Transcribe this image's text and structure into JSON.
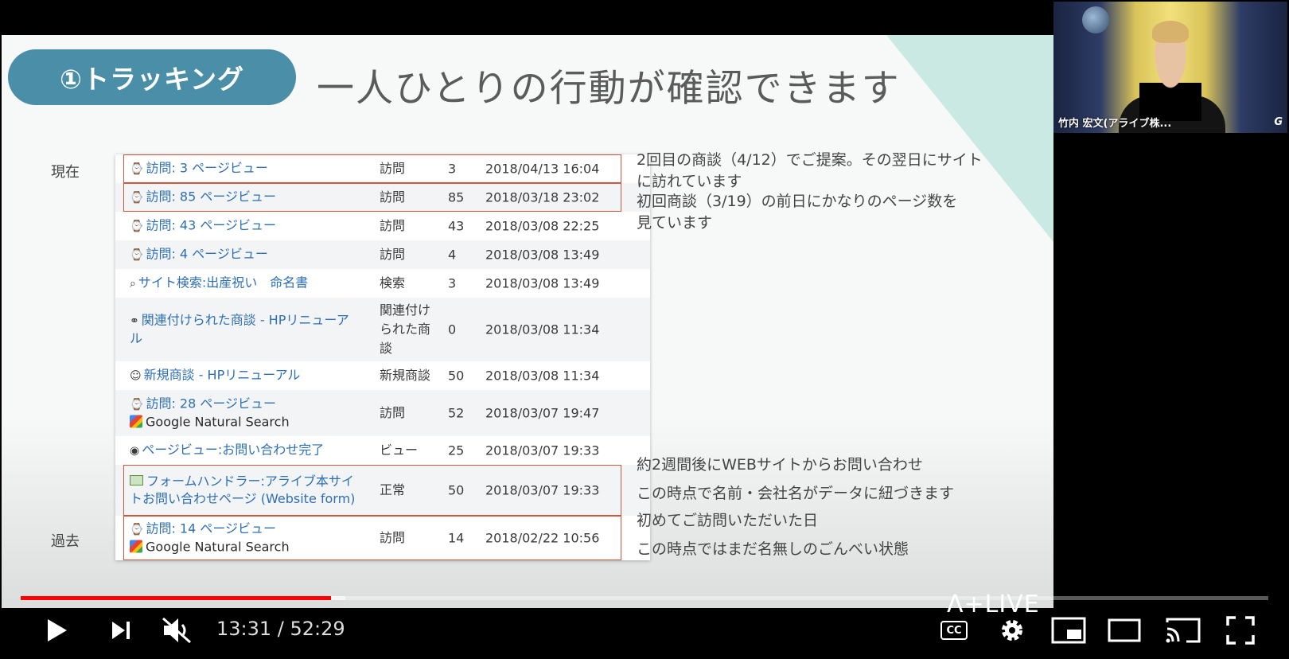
{
  "slide": {
    "pill": "①トラッキング",
    "headline": "一人ひとりの行動が確認できます",
    "label_now": "現在",
    "label_past": "過去"
  },
  "table": {
    "rows": [
      {
        "icon": "clock-icon",
        "title": "訪問: 3 ページビュー",
        "sub": "",
        "type": "訪問",
        "count": "3",
        "date": "2018/04/13 16:04"
      },
      {
        "icon": "clock-icon",
        "title": "訪問: 85 ページビュー",
        "sub": "",
        "type": "訪問",
        "count": "85",
        "date": "2018/03/18 23:02"
      },
      {
        "icon": "clock-icon",
        "title": "訪問: 43 ページビュー",
        "sub": "",
        "type": "訪問",
        "count": "43",
        "date": "2018/03/08 22:25"
      },
      {
        "icon": "clock-icon",
        "title": "訪問: 4 ページビュー",
        "sub": "",
        "type": "訪問",
        "count": "4",
        "date": "2018/03/08 13:49"
      },
      {
        "icon": "search-icon",
        "title": "サイト検索:出産祝い　命名書",
        "sub": "",
        "type": "検索",
        "count": "3",
        "date": "2018/03/08 13:49"
      },
      {
        "icon": "link-icon",
        "title": "関連付けられた商談 - HPリニューアル",
        "sub": "",
        "type": "関連付けられた商談",
        "count": "0",
        "date": "2018/03/08 11:34"
      },
      {
        "icon": "person-icon",
        "title": "新規商談 - HPリニューアル",
        "sub": "",
        "type": "新規商談",
        "count": "50",
        "date": "2018/03/08 11:34"
      },
      {
        "icon": "clock-icon",
        "title": "訪問: 28 ページビュー",
        "sub": "Google Natural Search",
        "type": "訪問",
        "count": "52",
        "date": "2018/03/07 19:47"
      },
      {
        "icon": "eye-icon",
        "title": "ページビュー:お問い合わせ完了",
        "sub": "",
        "type": "ビュー",
        "count": "25",
        "date": "2018/03/07 19:33"
      },
      {
        "icon": "form-icon",
        "title": "フォームハンドラー:アライブ本サイトお問い合わせページ (Website form)",
        "sub": "",
        "type": "正常",
        "count": "50",
        "date": "2018/03/07 19:33"
      },
      {
        "icon": "clock-icon",
        "title": "訪問: 14 ページビュー",
        "sub": "Google Natural Search",
        "type": "訪問",
        "count": "14",
        "date": "2018/02/22 10:56"
      }
    ]
  },
  "notes": {
    "n1": "2回目の商談（4/12）でご提案。その翌日にサイトに訪れています",
    "n2": "初回商談（3/19）の前日にかなりのページ数を見ています",
    "n3": "約2週間後にWEBサイトからお問い合わせ",
    "n4": "この時点で名前・会社名がデータに紐づきます",
    "n5": "初めてご訪問いただいた日",
    "n6": "この時点ではまだ名無しのごんべい状態"
  },
  "webcam": {
    "name": "竹内 宏文(アライブ株...",
    "badge": "G"
  },
  "player": {
    "time": "13:31 / 52:29",
    "progress_played": 0.2487,
    "progress_buffered": 0.26,
    "brand": "Λ+LIVE",
    "cc_label": "CC",
    "muted": true
  }
}
